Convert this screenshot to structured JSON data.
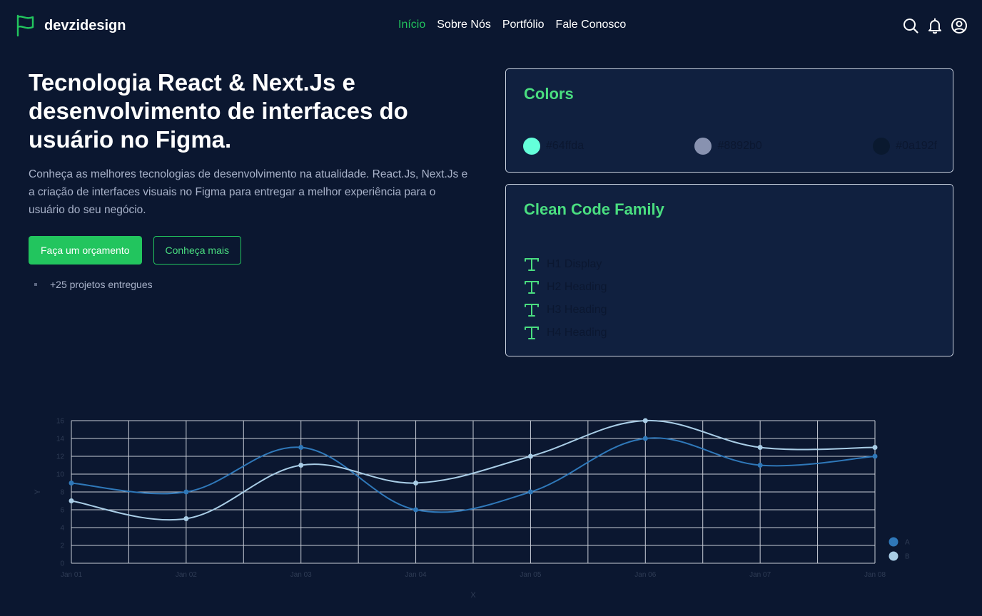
{
  "header": {
    "brand": "devzidesign",
    "nav": [
      {
        "label": "Início",
        "active": true
      },
      {
        "label": "Sobre Nós",
        "active": false
      },
      {
        "label": "Portfólio",
        "active": false
      },
      {
        "label": "Fale Conosco",
        "active": false
      }
    ],
    "icons": [
      "search-icon",
      "bell-icon",
      "user-icon"
    ]
  },
  "hero": {
    "title": "Tecnologia React & Next.Js e desenvolvimento de interfaces do usuário no Figma.",
    "description": "Conheça as melhores tecnologias de desenvolvimento na atualidade. React.Js, Next.Js e a criação de interfaces visuais no Figma para entregar a melhor experiência para o usuário do seu negócio.",
    "primary_button": "Faça um orçamento",
    "secondary_button": "Conheça mais",
    "stat": "+25 projetos entregues"
  },
  "colors_card": {
    "title": "Colors",
    "swatches": [
      {
        "label": "#64ffda",
        "color": "#64ffda"
      },
      {
        "label": "#8892b0",
        "color": "#8892b0"
      },
      {
        "label": "#0a192f",
        "color": "#0a192f"
      }
    ]
  },
  "fonts_card": {
    "title": "Clean Code Family",
    "items": [
      "H1 Display",
      "H2 Heading",
      "H3 Heading",
      "H4 Heading"
    ]
  },
  "theme": {
    "accent": "#22c55e",
    "accent_light": "#4ade80",
    "background": "#0b1730",
    "card": "#10203f"
  },
  "chart_data": {
    "type": "line",
    "x": [
      "Jan 01",
      "Jan 02",
      "Jan 03",
      "Jan 04",
      "Jan 05",
      "Jan 06",
      "Jan 07",
      "Jan 08"
    ],
    "series": [
      {
        "name": "A",
        "values": [
          9,
          8,
          13,
          6,
          8,
          14,
          11,
          12
        ],
        "color": "#2f78b9"
      },
      {
        "name": "B",
        "values": [
          7,
          5,
          11,
          9,
          12,
          16,
          13,
          13
        ],
        "color": "#a9cde6"
      }
    ],
    "xlabel": "X",
    "ylabel": "Y",
    "ylim": [
      0,
      16
    ],
    "yticks": [
      "0",
      "2",
      "4",
      "6",
      "8",
      "10",
      "12",
      "14",
      "16"
    ],
    "grid": true,
    "legend": "bottom-right"
  }
}
